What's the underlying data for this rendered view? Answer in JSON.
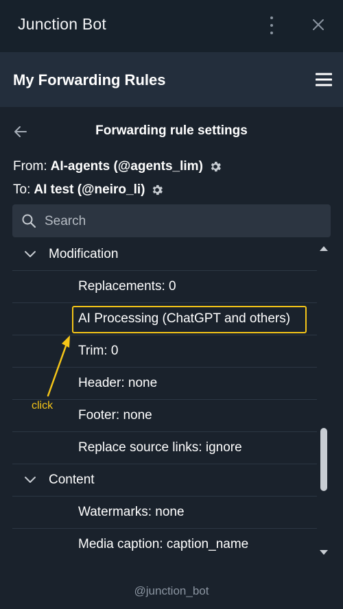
{
  "window": {
    "app_title": "Junction Bot",
    "menu_icon": "more-vertical-icon",
    "close_icon": "close-icon"
  },
  "header": {
    "title": "My Forwarding Rules",
    "menu_icon": "hamburger-icon"
  },
  "page": {
    "title": "Forwarding rule settings",
    "back_icon": "arrow-left-icon",
    "from_label": "From:",
    "from_value": "AI-agents (@agents_lim)",
    "to_label": "To:",
    "to_value": "AI test (@neiro_li)"
  },
  "search": {
    "placeholder": "Search"
  },
  "list": {
    "groups": [
      {
        "label": "Modification",
        "items": [
          "Replacements: 0",
          "AI Processing (ChatGPT and others)",
          "Trim: 0",
          "Header: none",
          "Footer: none",
          "Replace source links: ignore"
        ]
      },
      {
        "label": "Content",
        "items": [
          "Watermarks: none",
          "Media caption: caption_name"
        ]
      }
    ]
  },
  "annotation": {
    "label": "click",
    "color": "#f5c518"
  },
  "footer": {
    "text": "@junction_bot"
  },
  "colors": {
    "titlebar_bg": "#17212b",
    "header_bg": "#232e3c",
    "content_bg": "#1a222c",
    "search_bg": "#2c3541",
    "highlight": "#f5c518"
  }
}
